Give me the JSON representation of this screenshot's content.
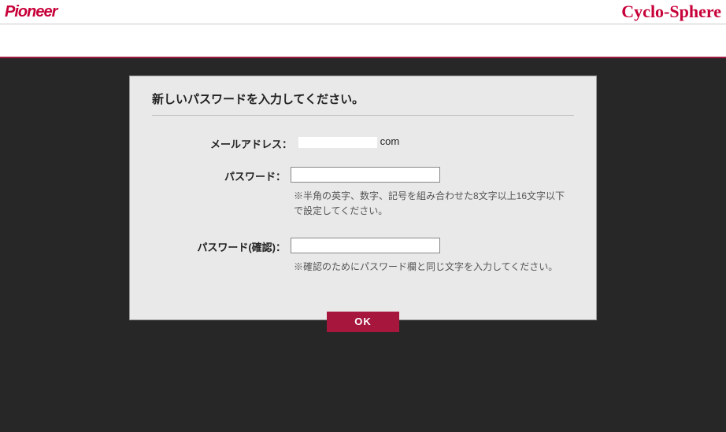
{
  "header": {
    "brand_left": "Pioneer",
    "brand_right": "Cyclo-Sphere"
  },
  "form": {
    "title": "新しいパスワードを入力してください。",
    "email_label": "メールアドレス：",
    "email_suffix": "com",
    "password_label": "パスワード：",
    "password_hint": "※半角の英字、数字、記号を組み合わせた8文字以上16文字以下で設定してください。",
    "password_confirm_label": "パスワード(確認)：",
    "password_confirm_hint": "※確認のためにパスワード欄と同じ文字を入力してください。",
    "ok_button": "OK"
  }
}
